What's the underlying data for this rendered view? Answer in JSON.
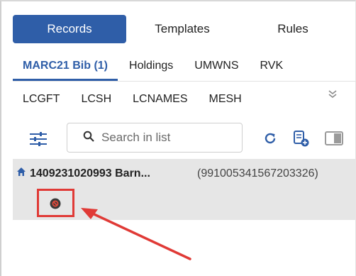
{
  "top_tabs": [
    "Records",
    "Templates",
    "Rules"
  ],
  "profile_tabs_row1": [
    "MARC21 Bib (1)",
    "Holdings",
    "UMWNS",
    "RVK"
  ],
  "profile_tabs_row2": [
    "LCGFT",
    "LCSH",
    "LCNAMES",
    "MESH"
  ],
  "search": {
    "placeholder": "Search in list"
  },
  "record": {
    "title": "1409231020993 Barn...",
    "id": "(991005341567203326)"
  },
  "icons": {
    "filter": "sliders-icon",
    "search": "search-icon",
    "refresh": "refresh-icon",
    "new_record": "new-record-icon",
    "toggle_view": "toggle-view-icon",
    "home": "home-icon",
    "blocked": "blocked-icon",
    "more": "chevron-double-down-icon"
  },
  "colors": {
    "accent": "#2f5ea8",
    "highlight": "#e03a36",
    "row_bg": "#e6e6e6"
  }
}
